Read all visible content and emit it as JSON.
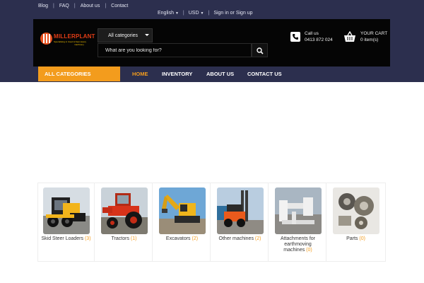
{
  "top_links": [
    "Blog",
    "FAQ",
    "About us",
    "Contact"
  ],
  "lang_bar": {
    "language": "English",
    "currency": "USD",
    "signin": "Sign in or Sign up"
  },
  "logo": {
    "name": "MILLERPLANT",
    "tagline": "Specialising in Used & New Heavy",
    "tagline2": "machinery"
  },
  "search": {
    "category": "All categories",
    "placeholder": "What are you looking for?"
  },
  "contact": {
    "label": "Call us",
    "phone": "0413 872 024"
  },
  "cart": {
    "title": "YOUR CART",
    "count": "0 item(s)"
  },
  "nav": {
    "all_categories": "ALL CATEGORIES",
    "items": [
      "HOME",
      "INVENTORY",
      "ABOUT US",
      "CONTACT US"
    ],
    "active": "HOME"
  },
  "categories": [
    {
      "name": "Skid Steer Loaders",
      "count": "(3)"
    },
    {
      "name": "Tractors",
      "count": "(1)"
    },
    {
      "name": "Excavators",
      "count": "(2)"
    },
    {
      "name": "Other machines",
      "count": "(2)"
    },
    {
      "name": "Attachments for",
      "name2": "earthmoving",
      "name3": "machines",
      "count": "(0)"
    },
    {
      "name": "Parts",
      "count": "(0)"
    }
  ],
  "colors": {
    "navy": "#2c2f4e",
    "header_black": "#050505",
    "accent_orange": "#f39c1d"
  }
}
